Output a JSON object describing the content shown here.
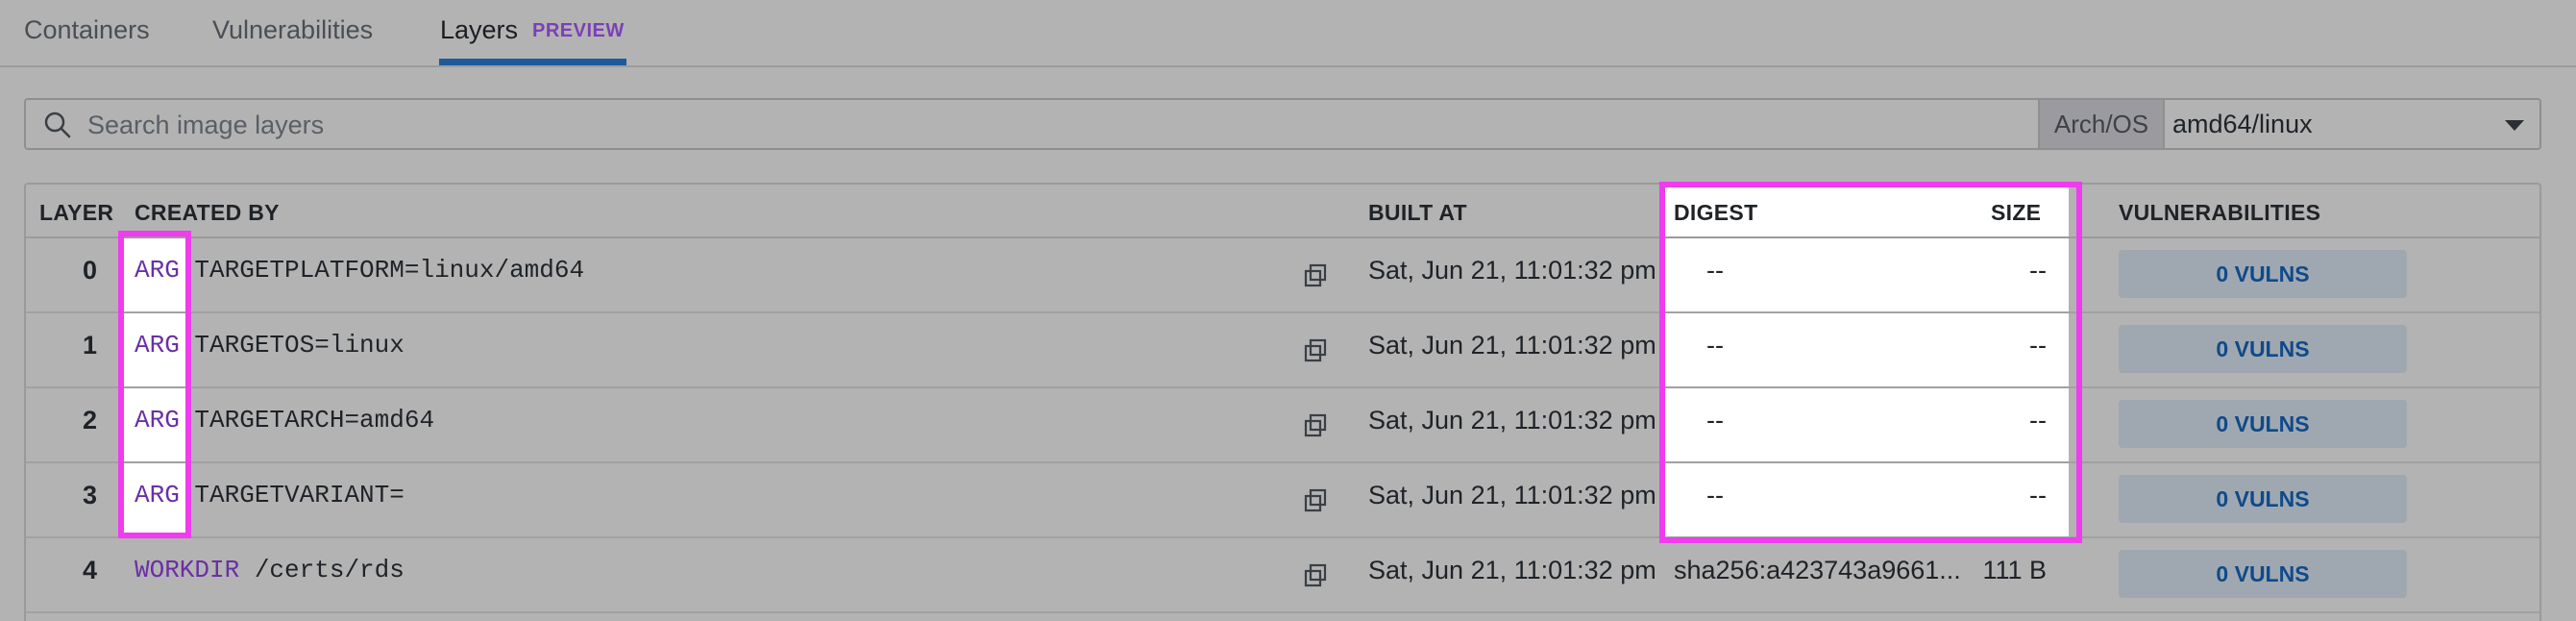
{
  "tabs": [
    {
      "label": "Containers"
    },
    {
      "label": "Vulnerabilities"
    },
    {
      "label": "Layers",
      "badge": "PREVIEW",
      "active": true
    }
  ],
  "search": {
    "placeholder": "Search image layers",
    "value": ""
  },
  "arch_os": {
    "label": "Arch/OS",
    "selected": "amd64/linux"
  },
  "table": {
    "headers": {
      "layer": "LAYER",
      "created_by": "CREATED BY",
      "built_at": "BUILT AT",
      "digest": "DIGEST",
      "size": "SIZE",
      "vulnerabilities": "VULNERABILITIES"
    },
    "rows": [
      {
        "layer": "0",
        "keyword": "ARG",
        "args": "TARGETPLATFORM=linux/amd64",
        "built_at": "Sat, Jun 21, 11:01:32 pm",
        "digest": "--",
        "size": "--",
        "vulns": "0 VULNS"
      },
      {
        "layer": "1",
        "keyword": "ARG",
        "args": "TARGETOS=linux",
        "built_at": "Sat, Jun 21, 11:01:32 pm",
        "digest": "--",
        "size": "--",
        "vulns": "0 VULNS"
      },
      {
        "layer": "2",
        "keyword": "ARG",
        "args": "TARGETARCH=amd64",
        "built_at": "Sat, Jun 21, 11:01:32 pm",
        "digest": "--",
        "size": "--",
        "vulns": "0 VULNS"
      },
      {
        "layer": "3",
        "keyword": "ARG",
        "args": "TARGETVARIANT=",
        "built_at": "Sat, Jun 21, 11:01:32 pm",
        "digest": "--",
        "size": "--",
        "vulns": "0 VULNS"
      },
      {
        "layer": "4",
        "keyword": "WORKDIR",
        "args": "/certs/rds",
        "built_at": "Sat, Jun 21, 11:01:32 pm",
        "digest": "sha256:a423743a9661...",
        "size": "111 B",
        "vulns": "0 VULNS"
      }
    ]
  },
  "colors": {
    "accent": "#1d5b9a",
    "keyword": "#6a2fa5",
    "highlight": "#ee3cee",
    "preview_badge": "#7b3fb8"
  },
  "icons": [
    "search-icon",
    "chevron-down-icon",
    "copy-icon"
  ]
}
